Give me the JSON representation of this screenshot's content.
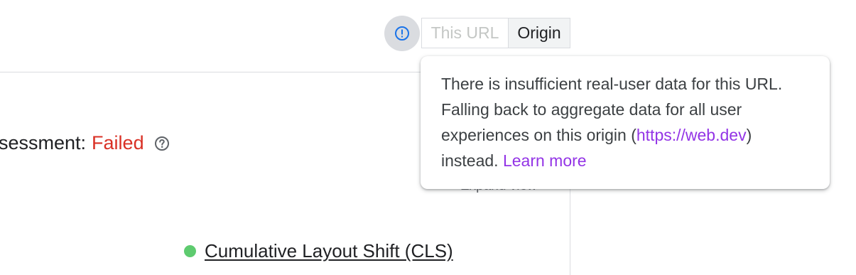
{
  "toggle": {
    "info_icon": "info-exclamation-icon",
    "url_label": "This URL",
    "origin_label": "Origin"
  },
  "assessment": {
    "label": "sessment:",
    "status": "Failed",
    "status_color": "#d93025",
    "help_icon": "help-circle-icon"
  },
  "expand": {
    "label": "Expand view"
  },
  "metric": {
    "name": "Cumulative Layout Shift (CLS)",
    "dot_color": "#5ecb6f"
  },
  "tooltip": {
    "text_before": "There is insufficient real-user data for this URL. Falling back to aggregate data for all user experiences on this origin (",
    "origin_link": "https://web.dev",
    "text_after": ") instead. ",
    "learn_more": "Learn more",
    "link_color": "#9334e6"
  }
}
